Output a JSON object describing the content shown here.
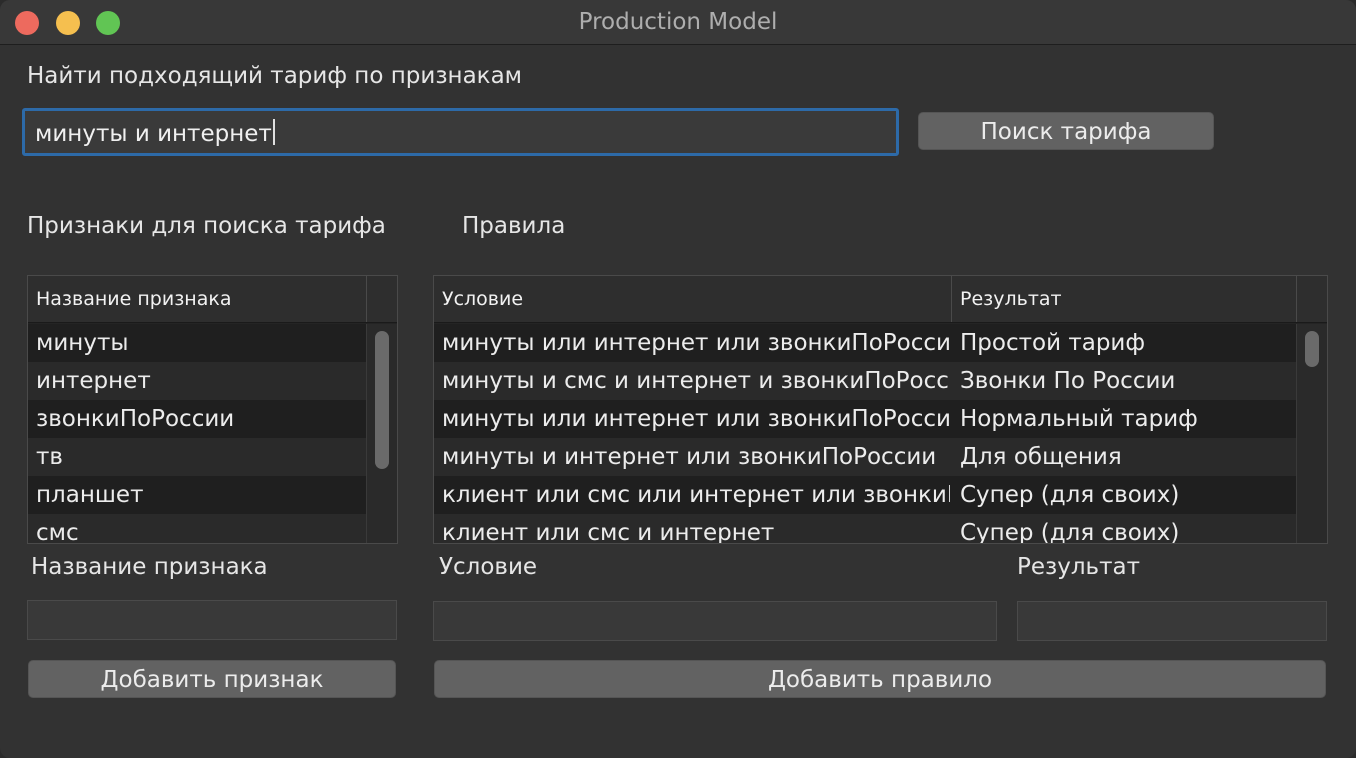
{
  "window": {
    "title": "Production Model"
  },
  "search": {
    "heading": "Найти подходящий тариф по признакам",
    "value": "минуты и интернет",
    "button_label": "Поиск тарифа"
  },
  "features": {
    "heading": "Признаки для поиска тарифа",
    "column_header": "Название признака",
    "items": [
      "минуты",
      "интернет",
      "звонкиПоРоссии",
      "тв",
      "планшет",
      "смс"
    ],
    "input_label": "Название признака",
    "input_value": "",
    "add_button_label": "Добавить признак"
  },
  "rules": {
    "heading": "Правила",
    "columns": [
      "Условие",
      "Результат"
    ],
    "rows": [
      {
        "condition": "минуты или интернет или звонкиПоРоссии",
        "result": "Простой тариф"
      },
      {
        "condition": "минуты и смс и интернет и звонкиПоРоссии",
        "result": "Звонки По России"
      },
      {
        "condition": "минуты или интернет или звонкиПоРоссии",
        "result": "Нормальный тариф"
      },
      {
        "condition": "минуты и интернет или звонкиПоРоссии",
        "result": "Для общения"
      },
      {
        "condition": "клиент или смс или интернет или звонкиПоРоссии",
        "result": "Супер (для своих)"
      },
      {
        "condition": "клиент или смс и интернет",
        "result": "Супер (для своих)"
      }
    ],
    "condition_label": "Условие",
    "condition_value": "",
    "result_label": "Результат",
    "result_value": "",
    "add_button_label": "Добавить правило"
  }
}
